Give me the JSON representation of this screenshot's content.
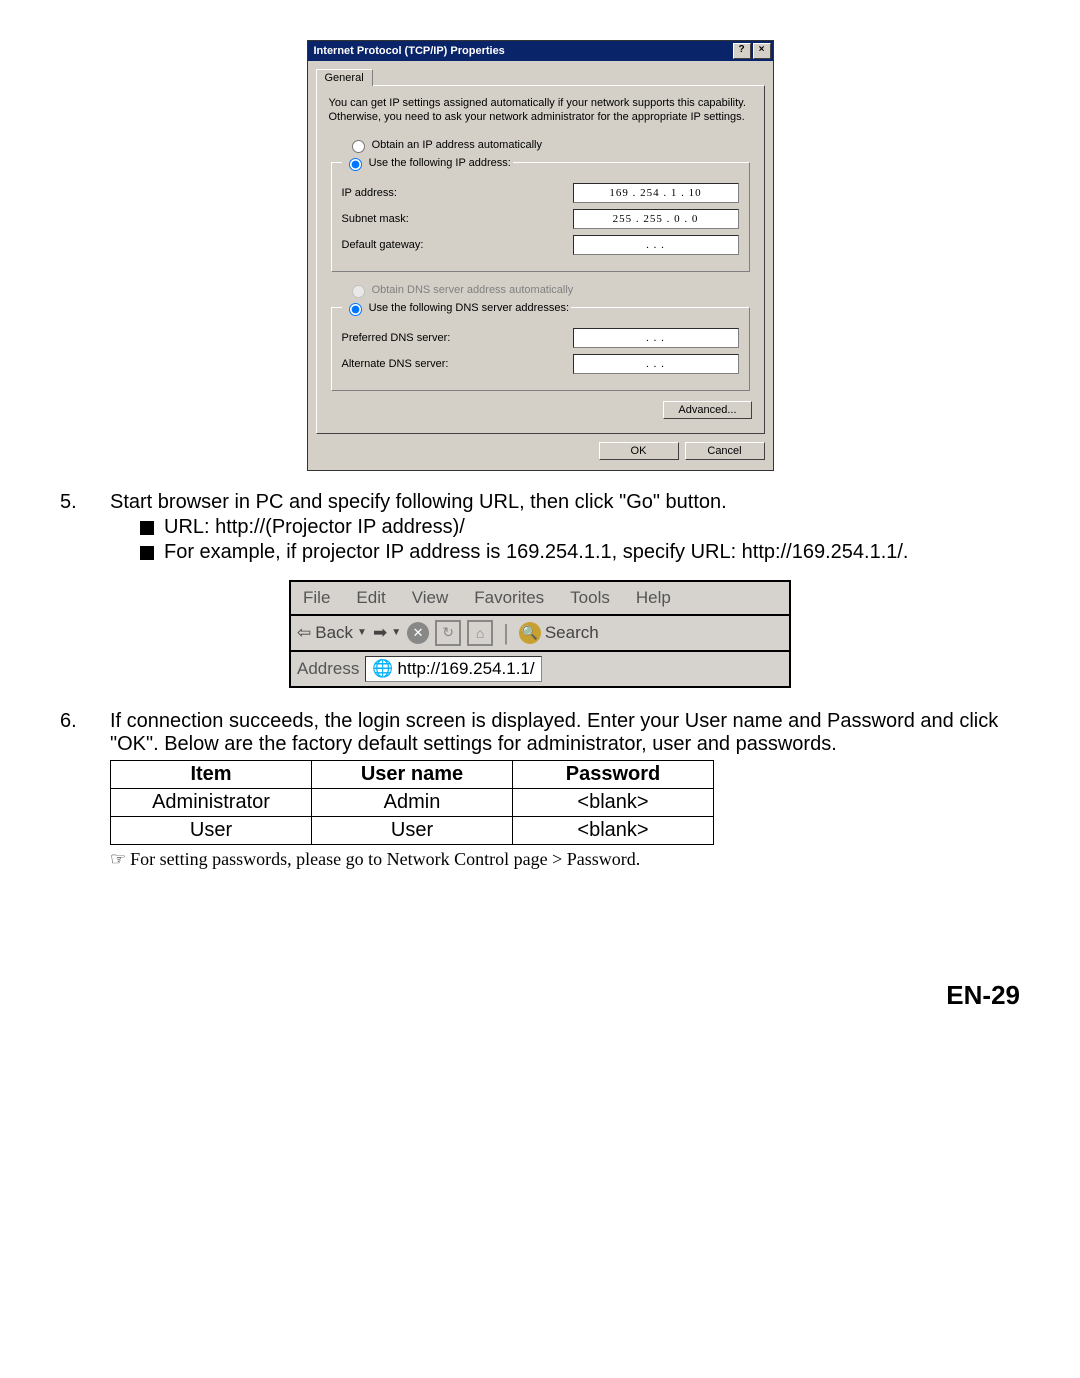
{
  "dialog": {
    "title": "Internet Protocol (TCP/IP) Properties",
    "help_btn": "?",
    "close_btn": "×",
    "tab_general": "General",
    "desc": "You can get IP settings assigned automatically if your network supports this capability. Otherwise, you need to ask your network administrator for the appropriate IP settings.",
    "radio_auto_ip": "Obtain an IP address automatically",
    "radio_manual_ip": "Use the following IP address:",
    "lbl_ip": "IP address:",
    "val_ip": "169 . 254 .   1   .  10",
    "lbl_subnet": "Subnet mask:",
    "val_subnet": "255 . 255 .   0   .   0",
    "lbl_gw": "Default gateway:",
    "val_gw": ".       .       .",
    "radio_auto_dns": "Obtain DNS server address automatically",
    "radio_manual_dns": "Use the following DNS server addresses:",
    "lbl_pref_dns": "Preferred DNS server:",
    "val_pref_dns": ".       .       .",
    "lbl_alt_dns": "Alternate DNS server:",
    "val_alt_dns": ".       .       .",
    "btn_advanced": "Advanced...",
    "btn_ok": "OK",
    "btn_cancel": "Cancel"
  },
  "steps": {
    "s5_num": "5.",
    "s5_text": "Start browser in PC and specify following URL, then click \"Go\" button.",
    "s5_b1": "URL: http://(Projector IP address)/",
    "s5_b2": "For example, if projector IP address is 169.254.1.1, specify URL: http://169.254.1.1/.",
    "s6_num": "6.",
    "s6_text": "If connection succeeds, the login screen is displayed. Enter your User name and Password and click \"OK\". Below are the factory default settings for administrator, user and passwords."
  },
  "ie": {
    "menu": [
      "File",
      "Edit",
      "View",
      "Favorites",
      "Tools",
      "Help"
    ],
    "back": "Back",
    "search": "Search",
    "addr_label": "Address",
    "url": "http://169.254.1.1/"
  },
  "table": {
    "h1": "Item",
    "h2": "User name",
    "h3": "Password",
    "r1c1": "Administrator",
    "r1c2": "Admin",
    "r1c3": "<blank>",
    "r2c1": "User",
    "r2c2": "User",
    "r2c3": "<blank>"
  },
  "note": "For setting passwords, please go to Network Control page > Password.",
  "page_num": "EN-29"
}
